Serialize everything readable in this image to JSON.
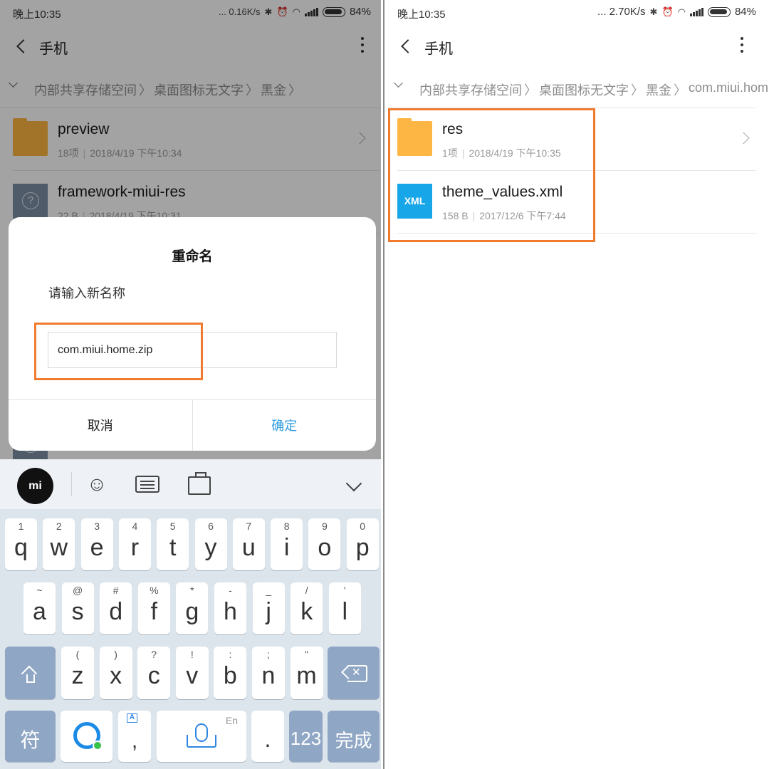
{
  "left": {
    "status": {
      "time": "晚上10:35",
      "speed": "... 0.16K/s",
      "battery": "84%"
    },
    "title": "手机",
    "breadcrumb": [
      "内部共享存储空间",
      "桌面图标无文字",
      "黑金"
    ],
    "files": [
      {
        "name": "preview",
        "count": "18项",
        "date": "2018/4/19 下午10:34"
      },
      {
        "name": "framework-miui-res",
        "size": "22 B",
        "date": "2018/4/19 下午10:31"
      }
    ],
    "dialog": {
      "title": "重命名",
      "message": "请输入新名称",
      "input_value": "com.miui.home.zip",
      "cancel": "取消",
      "ok": "确定"
    },
    "keyboard": {
      "logo": "mi",
      "row1": [
        {
          "hint": "1",
          "key": "q"
        },
        {
          "hint": "2",
          "key": "w"
        },
        {
          "hint": "3",
          "key": "e"
        },
        {
          "hint": "4",
          "key": "r"
        },
        {
          "hint": "5",
          "key": "t"
        },
        {
          "hint": "6",
          "key": "y"
        },
        {
          "hint": "7",
          "key": "u"
        },
        {
          "hint": "8",
          "key": "i"
        },
        {
          "hint": "9",
          "key": "o"
        },
        {
          "hint": "0",
          "key": "p"
        }
      ],
      "row2": [
        {
          "hint": "~",
          "key": "a"
        },
        {
          "hint": "@",
          "key": "s"
        },
        {
          "hint": "#",
          "key": "d"
        },
        {
          "hint": "%",
          "key": "f"
        },
        {
          "hint": "*",
          "key": "g"
        },
        {
          "hint": "-",
          "key": "h"
        },
        {
          "hint": "_",
          "key": "j"
        },
        {
          "hint": "/",
          "key": "k"
        },
        {
          "hint": "'",
          "key": "l"
        }
      ],
      "row3": [
        {
          "hint": "(",
          "key": "z"
        },
        {
          "hint": ")",
          "key": "x"
        },
        {
          "hint": "?",
          "key": "c"
        },
        {
          "hint": "!",
          "key": "v"
        },
        {
          "hint": ":",
          "key": "b"
        },
        {
          "hint": ";",
          "key": "n"
        },
        {
          "hint": "\"",
          "key": "m"
        }
      ],
      "symbols": "符",
      "comma": ",",
      "space_hint": "En",
      "period": ".",
      "num": "123",
      "done": "完成"
    }
  },
  "right": {
    "status": {
      "time": "晚上10:35",
      "speed": "... 2.70K/s",
      "battery": "84%"
    },
    "title": "手机",
    "breadcrumb": [
      "内部共享存储空间",
      "桌面图标无文字",
      "黑金",
      "com.miui.hom"
    ],
    "files": [
      {
        "name": "res",
        "count": "1项",
        "date": "2018/4/19 下午10:35"
      },
      {
        "name": "theme_values.xml",
        "size": "158 B",
        "date": "2017/12/6 下午7:44",
        "icon_label": "XML"
      }
    ]
  },
  "colors": {
    "accent": "#2f9ce0",
    "highlight": "#f07a2e",
    "folder": "#fdb643",
    "xml": "#17a6e7"
  }
}
